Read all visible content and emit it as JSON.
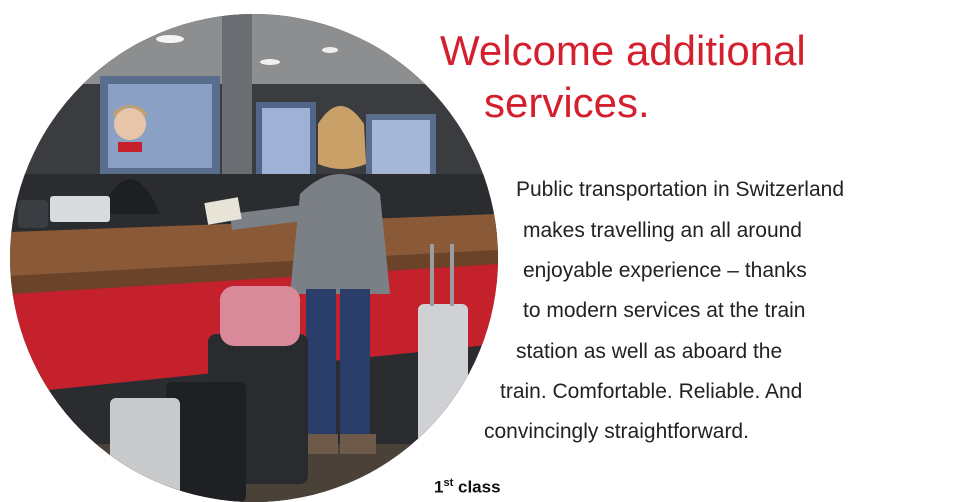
{
  "heading": {
    "lines": [
      "Welcome additional",
      "services."
    ]
  },
  "intro": {
    "lines": [
      "Public transportation in Switzerland",
      "makes travelling an all around",
      "enjoyable experience – thanks",
      "to modern services at the train",
      "station as well as aboard the",
      "train. Comfortable. Reliable. And",
      "convincingly straightforward."
    ]
  },
  "sub_heading": {
    "number": "1",
    "suffix": "st",
    "label": "class"
  },
  "photo": {
    "description_icon": "photo-travel-center",
    "colors": {
      "counter_red": "#c4212d",
      "counter_wood": "#8a5a38",
      "wall_dark": "#2d2f33"
    }
  }
}
